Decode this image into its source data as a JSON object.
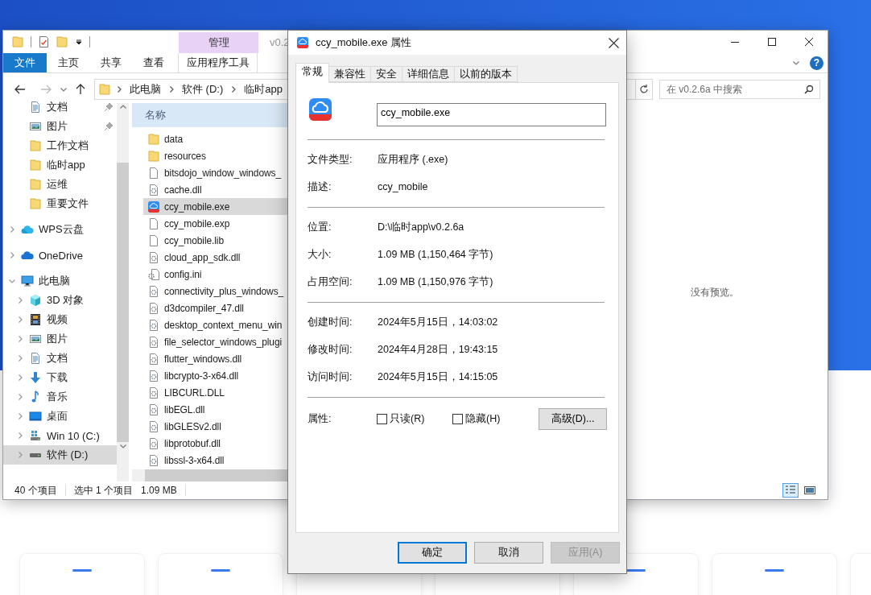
{
  "explorer": {
    "context_tab_group": "管理",
    "title": "v0.2",
    "ribbon_tabs": [
      {
        "label": "文件",
        "kind": "file-menu"
      },
      {
        "label": "主页",
        "kind": "tab"
      },
      {
        "label": "共享",
        "kind": "tab"
      },
      {
        "label": "查看",
        "kind": "tab"
      },
      {
        "label": "应用程序工具",
        "kind": "contextual"
      }
    ],
    "help_button": "?",
    "address_bar": {
      "crumbs": [
        "此电脑",
        "软件 (D:)",
        "临时app"
      ]
    },
    "search": {
      "placeholder": "在 v0.2.6a 中搜索"
    },
    "nav_pane": {
      "quick_access": [
        {
          "label": "文档",
          "kind": "documents",
          "pinned": true,
          "selected": false
        },
        {
          "label": "图片",
          "kind": "pictures",
          "pinned": true,
          "selected": false
        },
        {
          "label": "工作文档",
          "kind": "folder",
          "pinned": false,
          "selected": false
        },
        {
          "label": "临时app",
          "kind": "folder",
          "pinned": false,
          "selected": false
        },
        {
          "label": "运维",
          "kind": "folder",
          "pinned": false,
          "selected": false
        },
        {
          "label": "重要文件",
          "kind": "folder",
          "pinned": false,
          "selected": false
        }
      ],
      "tree": [
        {
          "label": "WPS云盘",
          "kind": "wps-cloud",
          "expanded": false,
          "selected": false
        },
        {
          "label": "OneDrive",
          "kind": "onedrive",
          "expanded": false,
          "selected": false
        },
        {
          "label": "此电脑",
          "kind": "pc",
          "expanded": true,
          "selected": false,
          "children": [
            {
              "label": "3D 对象",
              "kind": "objects",
              "expanded": false,
              "selected": false
            },
            {
              "label": "视频",
              "kind": "video",
              "expanded": false,
              "selected": false
            },
            {
              "label": "图片",
              "kind": "pictures",
              "expanded": false,
              "selected": false
            },
            {
              "label": "文档",
              "kind": "documents",
              "expanded": false,
              "selected": false
            },
            {
              "label": "下载",
              "kind": "download",
              "expanded": false,
              "selected": false
            },
            {
              "label": "音乐",
              "kind": "music",
              "expanded": false,
              "selected": false
            },
            {
              "label": "桌面",
              "kind": "desktop",
              "expanded": false,
              "selected": false
            },
            {
              "label": "Win 10 (C:)",
              "kind": "system-drive",
              "expanded": false,
              "selected": false
            },
            {
              "label": "软件 (D:)",
              "kind": "drive",
              "expanded": false,
              "selected": true
            }
          ]
        }
      ]
    },
    "file_list": {
      "columns": [
        "名称"
      ],
      "rows": [
        {
          "name": "data",
          "kind": "folder",
          "selected": false
        },
        {
          "name": "resources",
          "kind": "folder",
          "selected": false
        },
        {
          "name": "bitsdojo_window_windows_",
          "kind": "file",
          "selected": false
        },
        {
          "name": "cache.dll",
          "kind": "dll",
          "selected": false
        },
        {
          "name": "ccy_mobile.exe",
          "kind": "exe",
          "selected": true
        },
        {
          "name": "ccy_mobile.exp",
          "kind": "file",
          "selected": false
        },
        {
          "name": "ccy_mobile.lib",
          "kind": "file",
          "selected": false
        },
        {
          "name": "cloud_app_sdk.dll",
          "kind": "dll",
          "selected": false
        },
        {
          "name": "config.ini",
          "kind": "config",
          "selected": false
        },
        {
          "name": "connectivity_plus_windows_",
          "kind": "dll",
          "selected": false
        },
        {
          "name": "d3dcompiler_47.dll",
          "kind": "dll",
          "selected": false
        },
        {
          "name": "desktop_context_menu_win",
          "kind": "dll",
          "selected": false
        },
        {
          "name": "file_selector_windows_plugi",
          "kind": "dll",
          "selected": false
        },
        {
          "name": "flutter_windows.dll",
          "kind": "dll",
          "selected": false
        },
        {
          "name": "libcrypto-3-x64.dll",
          "kind": "dll",
          "selected": false
        },
        {
          "name": "LIBCURL.DLL",
          "kind": "dll",
          "selected": false
        },
        {
          "name": "libEGL.dll",
          "kind": "dll",
          "selected": false
        },
        {
          "name": "libGLESv2.dll",
          "kind": "dll",
          "selected": false
        },
        {
          "name": "libprotobuf.dll",
          "kind": "dll",
          "selected": false
        },
        {
          "name": "libssl-3-x64.dll",
          "kind": "dll",
          "selected": false
        }
      ]
    },
    "preview": "没有预览。",
    "status_bar": {
      "item_count": "40 个项目",
      "selection": "选中 1 个项目",
      "size": "1.09 MB"
    },
    "view_buttons": [
      {
        "kind": "details",
        "selected": true
      },
      {
        "kind": "large-icons",
        "selected": false
      }
    ]
  },
  "dialog": {
    "title": "ccy_mobile.exe 属性",
    "tabs": [
      {
        "label": "常规",
        "selected": true
      },
      {
        "label": "兼容性",
        "selected": false
      },
      {
        "label": "安全",
        "selected": false
      },
      {
        "label": "详细信息",
        "selected": false
      },
      {
        "label": "以前的版本",
        "selected": false
      }
    ],
    "file_name": "ccy_mobile.exe",
    "groups": [
      [
        {
          "label": "文件类型:",
          "value": "应用程序 (.exe)"
        },
        {
          "label": "描述:",
          "value": "ccy_mobile"
        }
      ],
      [
        {
          "label": "位置:",
          "value": "D:\\临时app\\v0.2.6a"
        },
        {
          "label": "大小:",
          "value": "1.09 MB (1,150,464 字节)"
        },
        {
          "label": "占用空间:",
          "value": "1.09 MB (1,150,976 字节)"
        }
      ],
      [
        {
          "label": "创建时间:",
          "value": "2024年5月15日，14:03:02"
        },
        {
          "label": "修改时间:",
          "value": "2024年4月28日，19:43:15"
        },
        {
          "label": "访问时间:",
          "value": "2024年5月15日，14:15:05"
        }
      ]
    ],
    "attributes": {
      "label": "属性:",
      "options": [
        {
          "label": "只读(R)",
          "checked": false
        },
        {
          "label": "隐藏(H)",
          "checked": false
        }
      ],
      "advanced_button": "高级(D)..."
    },
    "buttons": [
      {
        "label": "确定",
        "kind": "confirm",
        "disabled": false
      },
      {
        "label": "取消",
        "kind": "cancel",
        "disabled": false
      },
      {
        "label": "应用(A)",
        "kind": "apply",
        "disabled": true
      }
    ]
  }
}
